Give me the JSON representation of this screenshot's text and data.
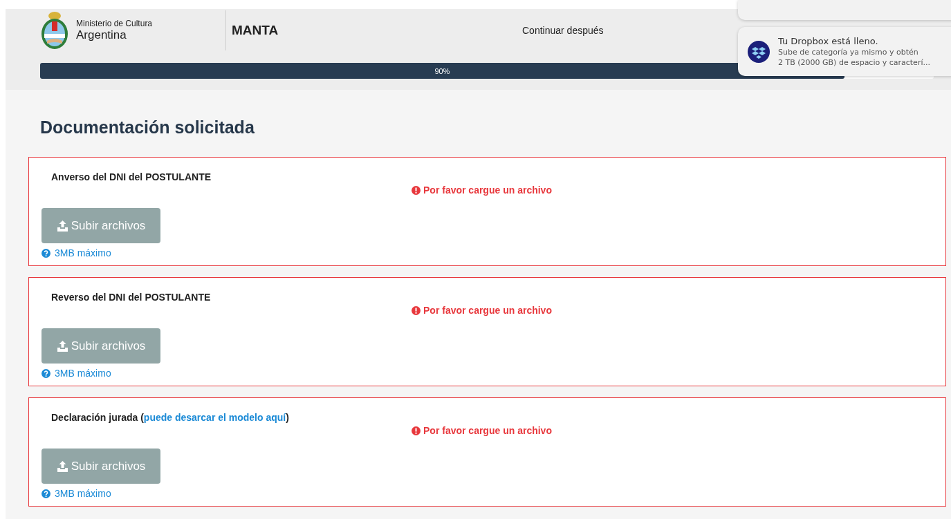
{
  "header": {
    "org_line1": "Ministerio de Cultura",
    "org_line2": "Argentina",
    "project": "MANTA",
    "continue_link": "Continuar después",
    "progress": {
      "level": 0.9,
      "label": "90%"
    }
  },
  "notifications": [
    {
      "kind": "partial"
    },
    {
      "kind": "full",
      "title": "Tu Dropbox está lleno.",
      "line1": "Sube de categoría ya mismo y obtén",
      "line2": "2 TB (2000 GB) de espacio y caracterí..."
    }
  ],
  "page_title": "Documentación solicitada",
  "documents": [
    {
      "label": "Anverso del DNI del POSTULANTE",
      "error": "Por favor cargue un archivo",
      "button": "Subir archivos",
      "hint": "3MB máximo"
    },
    {
      "label": "Reverso del DNI del POSTULANTE",
      "error": "Por favor cargue un archivo",
      "button": "Subir archivos",
      "hint": "3MB máximo"
    },
    {
      "label": "Declaración jurada (",
      "link": "puede desarcar el modelo aquí",
      "label_after": ")",
      "error": "Por favor cargue un archivo",
      "button": "Subir archivos",
      "hint": "3MB máximo"
    }
  ]
}
